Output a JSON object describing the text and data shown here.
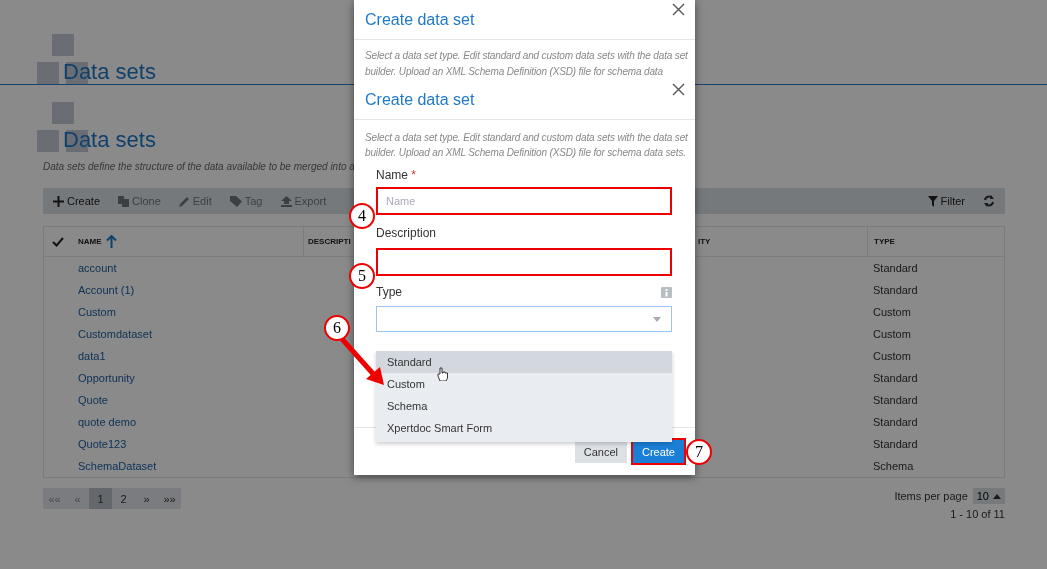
{
  "page": {
    "headings": [
      "Data sets",
      "Data sets"
    ],
    "description": "Data sets define the structure of the data available to be merged into a",
    "toolbar": [
      {
        "kind": "plus",
        "label": "Create",
        "disabled": false
      },
      {
        "kind": "clone",
        "label": "Clone",
        "disabled": true
      },
      {
        "kind": "edit",
        "label": "Edit",
        "disabled": true
      },
      {
        "kind": "tag",
        "label": "Tag",
        "disabled": true
      },
      {
        "kind": "export",
        "label": "Export",
        "disabled": true
      }
    ],
    "filter": "Filter",
    "table": {
      "columns": [
        {
          "label": "NAME",
          "sorted": true
        },
        {
          "label": "DESCRIPTI"
        },
        {
          "label": "ITY"
        },
        {
          "label": "TYPE"
        }
      ],
      "rows": [
        {
          "name": "account",
          "type": "Standard"
        },
        {
          "name": "Account (1)",
          "type": "Standard"
        },
        {
          "name": "Custom",
          "type": "Custom"
        },
        {
          "name": "Customdataset",
          "type": "Custom"
        },
        {
          "name": "data1",
          "type": "Custom"
        },
        {
          "name": "Opportunity",
          "type": "Standard"
        },
        {
          "name": "Quote",
          "type": "Standard"
        },
        {
          "name": "quote demo",
          "type": "Standard"
        },
        {
          "name": "Quote123",
          "type": "Standard"
        },
        {
          "name": "SchemaDataset",
          "type": "Schema"
        }
      ]
    },
    "pagination": [
      {
        "label": "««",
        "selected": false,
        "disabled": true
      },
      {
        "label": "«",
        "selected": false,
        "disabled": true
      },
      {
        "label": "1",
        "selected": true,
        "disabled": false
      },
      {
        "label": "2",
        "selected": false,
        "disabled": false
      },
      {
        "label": "»",
        "selected": false,
        "disabled": false
      },
      {
        "label": "»»",
        "selected": false,
        "disabled": false
      }
    ],
    "items_per_page": {
      "label": "Items per page",
      "value": "10"
    },
    "range": "1 - 10 of 11"
  },
  "dialog_ghost": {
    "title": "Create data set",
    "description": "Select a data set type. Edit standard and custom data sets with the data set builder. Upload an XML Schema Definition (XSD) file for schema data"
  },
  "dialog": {
    "title": "Create data set",
    "description": "Select a data set type. Edit standard and custom data sets with the data set builder. Upload an XML Schema Definition (XSD) file for schema data sets.",
    "name": {
      "label": "Name",
      "required": "*",
      "placeholder": "Name",
      "highlighted": true
    },
    "description_field": {
      "label": "Description",
      "highlighted": true
    },
    "type": {
      "label": "Type",
      "options": [
        {
          "label": "Standard",
          "hovered": true
        },
        {
          "label": "Custom",
          "hovered": false
        },
        {
          "label": "Schema",
          "hovered": false
        },
        {
          "label": "Xpertdoc Smart Form",
          "hovered": false
        }
      ]
    },
    "buttons": [
      {
        "kind": "secondary",
        "label": "Cancel",
        "highlighted": false
      },
      {
        "kind": "primary",
        "label": "Create",
        "highlighted": true
      }
    ]
  },
  "annotations": [
    "4",
    "5",
    "6",
    "7"
  ]
}
